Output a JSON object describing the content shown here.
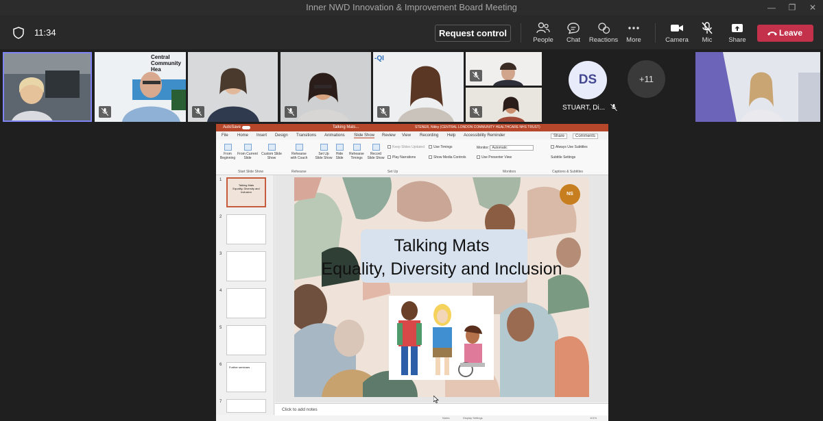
{
  "window": {
    "title": "Inner NWD Innovation & Improvement Board Meeting"
  },
  "meeting": {
    "time": "11:34",
    "request_control": "Request control"
  },
  "toolbar": {
    "people": "People",
    "chat": "Chat",
    "reactions": "Reactions",
    "more": "More",
    "camera": "Camera",
    "mic": "Mic",
    "share": "Share",
    "leave": "Leave"
  },
  "participants": {
    "ds_initials": "DS",
    "ds_name": "STUART, Di...",
    "overflow": "+11"
  },
  "tile_texts": {
    "t2_label": "Central",
    "t2_label2": "Community Hea",
    "t5_label": "-QI"
  },
  "ppt": {
    "autosave": "AutoSave",
    "title": "Talking Mats...",
    "user": "STENER, Nikky (CENTRAL LONDON COMMUNITY HEALTHCARE NHS TRUST)",
    "menu": [
      "File",
      "Home",
      "Insert",
      "Design",
      "Transitions",
      "Animations",
      "Slide Show",
      "Review",
      "View",
      "Recording",
      "Help",
      "Accessibility Reminder"
    ],
    "share": "Share",
    "comments": "Comments",
    "ribbon": {
      "from_beginning": "From Beginning",
      "from_current": "From Current Slide",
      "custom": "Custom Slide Show",
      "rehearse_coach": "Rehearse with Coach",
      "setup": "Set Up Slide Show",
      "hide": "Hide Slide",
      "rehearse_timings": "Rehearse Timings",
      "record": "Record Slide Show",
      "keep_updated": "Keep Slides Updated",
      "use_timings": "Use Timings",
      "play_narrations": "Play Narrations",
      "show_media": "Show Media Controls",
      "monitor": "Monitor:",
      "monitor_val": "Automatic",
      "presenter_view": "Use Presenter View",
      "subtitles": "Always Use Subtitles",
      "subtitle_settings": "Subtitle Settings",
      "grp_start": "Start Slide Show",
      "grp_rehearse": "Rehearse",
      "grp_setup": "Set Up",
      "grp_monitors": "Monitors",
      "grp_captions": "Captions & Subtitles"
    },
    "slide": {
      "line1": "Talking Mats",
      "line2": "Equality, Diversity and Inclusion",
      "badge": "NS"
    },
    "notes": "Click to add notes",
    "status": {
      "notes": "Notes",
      "display": "Display Settings",
      "zoom": "101%"
    },
    "thumbs": [
      "1",
      "2",
      "3",
      "4",
      "5",
      "6",
      "7"
    ],
    "thumb_captions": {
      "t1": "Talking Mats",
      "t1b": "Equality, Diversity and Inclusion",
      "t6": "Further seminars"
    }
  }
}
